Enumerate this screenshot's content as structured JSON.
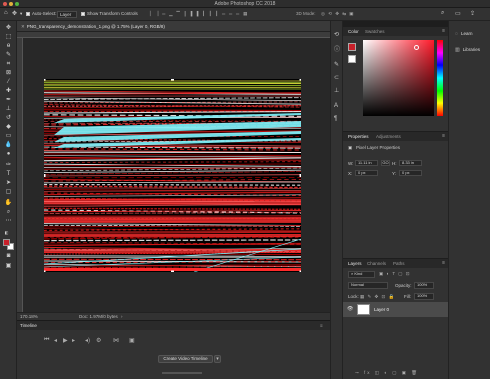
{
  "window": {
    "title": "Adobe Photoshop CC 2018"
  },
  "options_bar": {
    "auto_select_label": "Auto-Select:",
    "auto_select_value": "Layer",
    "show_transform_label": "Show Transform Controls"
  },
  "document": {
    "tab_label": "PNG_transparency_demonstration_1.png @ 1.75% (Layer 0, RGB/8)",
    "zoom": "170.18%",
    "doc_info": "Doc: 1.97M/0 bytes"
  },
  "timeline": {
    "title": "Timeline",
    "create_button": "Create Video Timeline"
  },
  "color_panel": {
    "tabs": [
      "Color",
      "Swatches"
    ]
  },
  "properties_panel": {
    "tabs": [
      "Properties",
      "Adjustments"
    ],
    "subtitle": "Pixel Layer Properties",
    "w_label": "W:",
    "w_value": "11.11 in",
    "go_label": "GO",
    "h_label": "H:",
    "h_value": "8.33 in",
    "x_label": "X:",
    "x_value": "0 px",
    "y_label": "Y:",
    "y_value": "0 px"
  },
  "layers_panel": {
    "tabs": [
      "Layers",
      "Channels",
      "Paths"
    ],
    "filter_kind": "Kind",
    "blend_mode": "Normal",
    "opacity_label": "Opacity:",
    "opacity_value": "100%",
    "lock_label": "Lock:",
    "fill_label": "Fill:",
    "fill_value": "100%",
    "layer_name": "Layer 0"
  },
  "right_panel": {
    "learn_label": "Learn",
    "libraries_label": "Libraries"
  },
  "colors": {
    "foreground": "#c8202a",
    "background": "#ffffff"
  }
}
